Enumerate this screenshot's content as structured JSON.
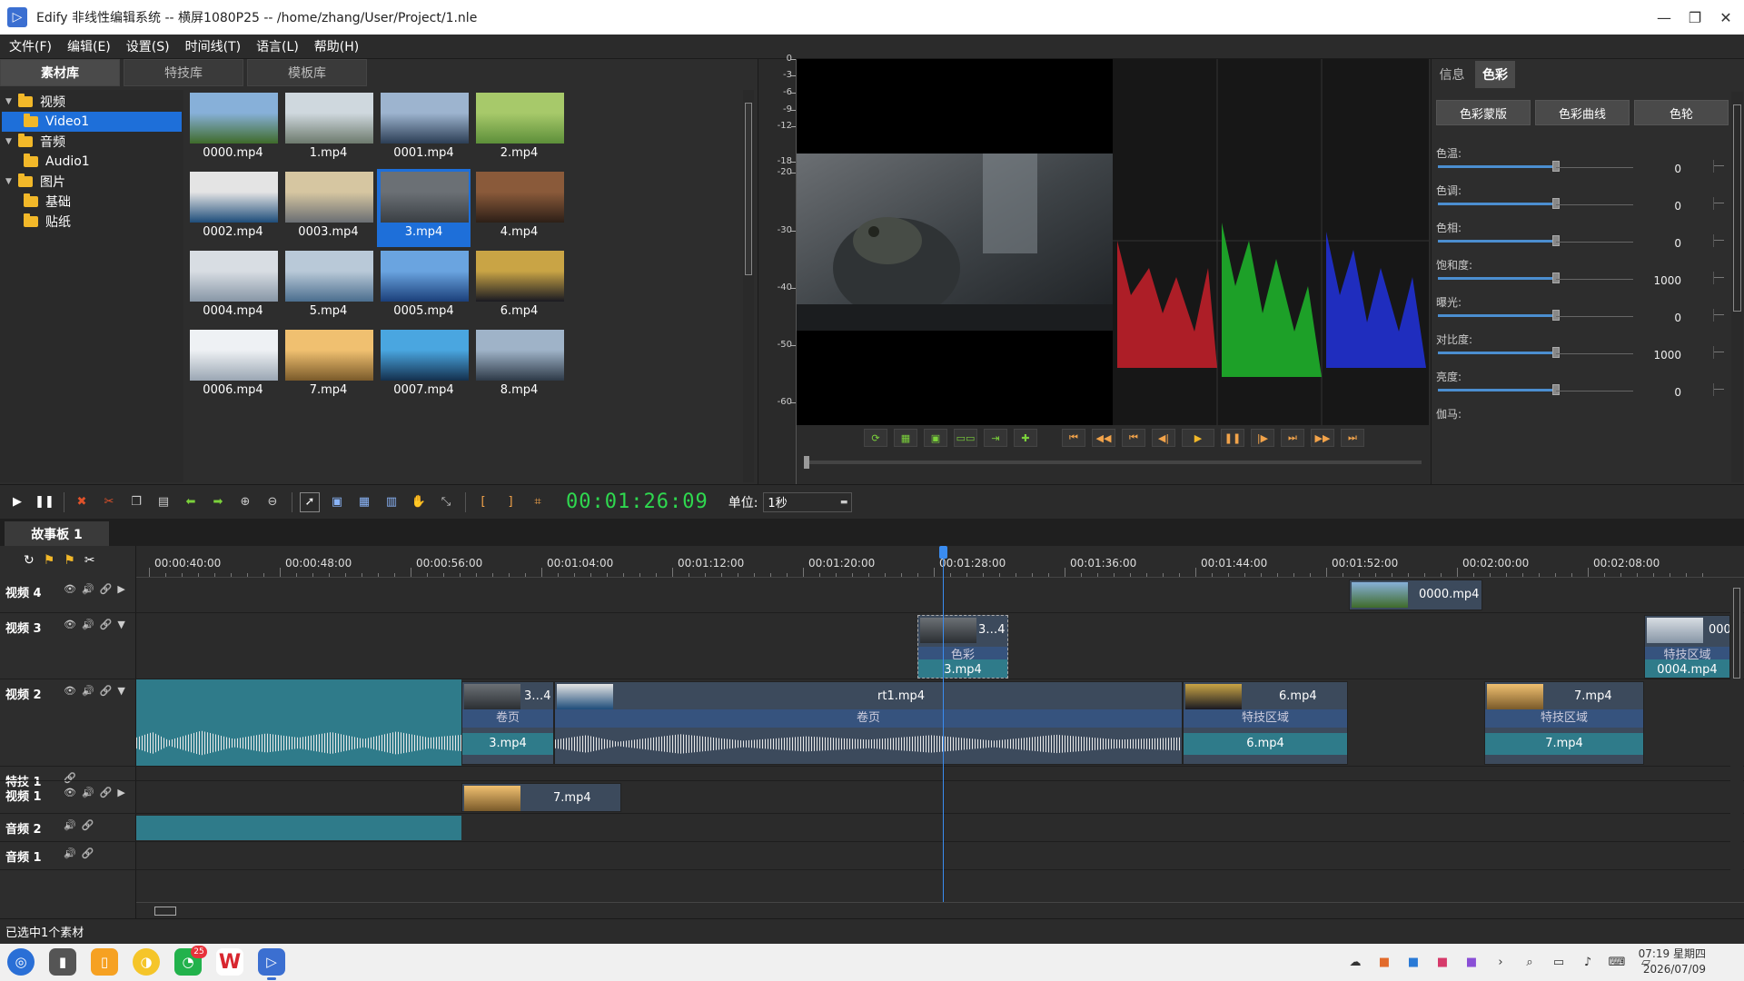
{
  "window": {
    "title": "Edify 非线性编辑系统 -- 横屏1080P25 -- /home/zhang/User/Project/1.nle",
    "logo": "▷",
    "min": "—",
    "restore": "❐",
    "close": "✕"
  },
  "menu": [
    "文件(F)",
    "编辑(E)",
    "设置(S)",
    "时间线(T)",
    "语言(L)",
    "帮助(H)"
  ],
  "library": {
    "tabs": [
      "素材库",
      "特技库",
      "模板库"
    ],
    "tree": [
      {
        "label": "视频",
        "level": 0,
        "expanded": true,
        "selected": false
      },
      {
        "label": "Video1",
        "level": 1,
        "expanded": false,
        "selected": true
      },
      {
        "label": "音频",
        "level": 0,
        "expanded": true,
        "selected": false
      },
      {
        "label": "Audio1",
        "level": 1,
        "expanded": false,
        "selected": false
      },
      {
        "label": "图片",
        "level": 0,
        "expanded": true,
        "selected": false
      },
      {
        "label": "基础",
        "level": 1,
        "expanded": false,
        "selected": false
      },
      {
        "label": "贴纸",
        "level": 1,
        "expanded": false,
        "selected": false
      }
    ],
    "files": [
      {
        "name": "0000.mp4",
        "selected": false
      },
      {
        "name": "1.mp4",
        "selected": false
      },
      {
        "name": "0001.mp4",
        "selected": false
      },
      {
        "name": "2.mp4",
        "selected": false
      },
      {
        "name": "0002.mp4",
        "selected": false
      },
      {
        "name": "0003.mp4",
        "selected": false
      },
      {
        "name": "3.mp4",
        "selected": true
      },
      {
        "name": "4.mp4",
        "selected": false
      },
      {
        "name": "0004.mp4",
        "selected": false
      },
      {
        "name": "5.mp4",
        "selected": false
      },
      {
        "name": "0005.mp4",
        "selected": false
      },
      {
        "name": "6.mp4",
        "selected": false
      },
      {
        "name": "0006.mp4",
        "selected": false
      },
      {
        "name": "7.mp4",
        "selected": false
      },
      {
        "name": "0007.mp4",
        "selected": false
      },
      {
        "name": "8.mp4",
        "selected": false
      }
    ]
  },
  "meter": {
    "ticks": [
      "0",
      "-3",
      "-6",
      "-9",
      "-12",
      "-18",
      "-20",
      "-30",
      "-40",
      "-50",
      "-60"
    ]
  },
  "preview_toolbar": [
    "loop",
    "fit",
    "safe",
    "dual",
    "split",
    "add",
    "start",
    "rewind",
    "prev-mark",
    "prev-frame",
    "play",
    "pause",
    "next-frame",
    "next-mark",
    "forward",
    "end"
  ],
  "right_panel": {
    "tabs": [
      "信息",
      "色彩"
    ],
    "active_tab": "色彩",
    "buttons": [
      "色彩蒙版",
      "色彩曲线",
      "色轮"
    ],
    "params": [
      {
        "label": "色温:",
        "value": "0",
        "level": 0.5
      },
      {
        "label": "色调:",
        "value": "0",
        "level": 0.5
      },
      {
        "label": "色相:",
        "value": "0",
        "level": 0.5
      },
      {
        "label": "饱和度:",
        "value": "1000",
        "level": 0.5
      },
      {
        "label": "曝光:",
        "value": "0",
        "level": 0.5
      },
      {
        "label": "对比度:",
        "value": "1000",
        "level": 0.5
      },
      {
        "label": "亮度:",
        "value": "0",
        "level": 0.5
      },
      {
        "label": "伽马:",
        "value": "",
        "level": null
      }
    ]
  },
  "timeline_toolbar": {
    "timecode": "00:01:26:09",
    "unit_label": "单位:",
    "unit_value": "1秒"
  },
  "storyboard": {
    "tab": "故事板 1"
  },
  "ruler": [
    "00:00:40:00",
    "00:00:48:00",
    "00:00:56:00",
    "00:01:04:00",
    "00:01:12:00",
    "00:01:20:00",
    "00:01:28:00",
    "00:01:36:00",
    "00:01:44:00",
    "00:01:52:00",
    "00:02:00:00",
    "00:02:08:00"
  ],
  "tracks": [
    {
      "name": "视频 4"
    },
    {
      "name": "视频 3"
    },
    {
      "name": "视频 2"
    },
    {
      "name": "特技 1"
    },
    {
      "name": "视频 1"
    },
    {
      "name": "音频 2"
    },
    {
      "name": "音频 1"
    }
  ],
  "clips": {
    "v4_a": {
      "title": "0000.mp4"
    },
    "v3_a": {
      "title": "3…4",
      "fx": "色彩",
      "low": "3.mp4"
    },
    "v3_b": {
      "title": "000",
      "fx": "特技区域",
      "low": "0004.mp4"
    },
    "v2_a": {
      "title": "3…4",
      "fx": "卷页",
      "low": "3.mp4"
    },
    "v2_b": {
      "title": "rt1.mp4",
      "fx": "卷页"
    },
    "v2_c": {
      "title": "6.mp4",
      "fx": "特技区域",
      "low": "6.mp4"
    },
    "v2_d": {
      "title": "7.mp4",
      "fx": "特技区域",
      "low": "7.mp4"
    },
    "v1_a": {
      "title": "7.mp4"
    }
  },
  "status": "已选中1个素材",
  "taskbar": {
    "badge": "25",
    "time": "07:19 星期四",
    "date": "2026/07/09"
  },
  "colors": {
    "accent": "#1e6fd9",
    "timecode": "#2fd84f",
    "clip_fx": "#36537e",
    "clip_low": "#2f7b8a"
  }
}
